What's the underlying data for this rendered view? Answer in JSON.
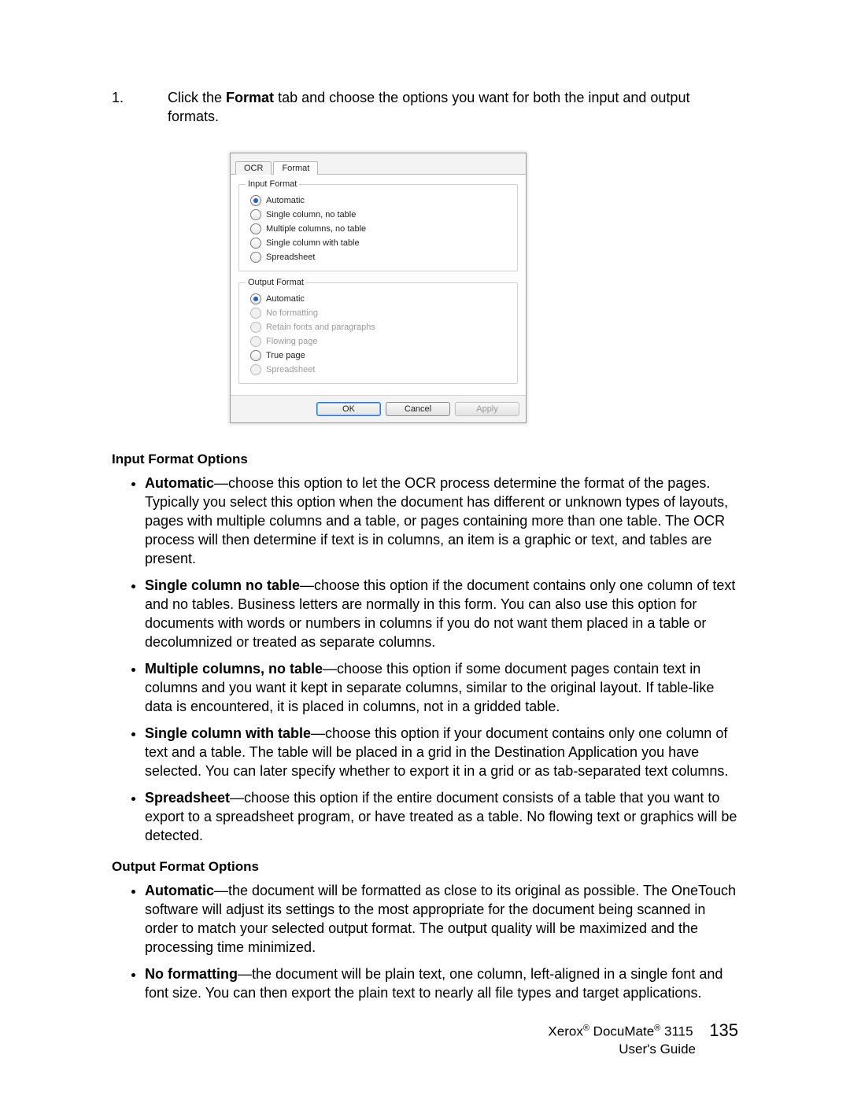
{
  "step": {
    "number": "1.",
    "before": "Click the ",
    "bold": "Format",
    "after": " tab and choose the options you want for both the input and output formats."
  },
  "dialog": {
    "tabs": {
      "ocr": "OCR",
      "format": "Format"
    },
    "input_group": {
      "legend": "Input Format",
      "options": [
        {
          "label": "Automatic",
          "selected": true,
          "disabled": false
        },
        {
          "label": "Single column, no table",
          "selected": false,
          "disabled": false
        },
        {
          "label": "Multiple columns, no table",
          "selected": false,
          "disabled": false
        },
        {
          "label": "Single column with table",
          "selected": false,
          "disabled": false
        },
        {
          "label": "Spreadsheet",
          "selected": false,
          "disabled": false
        }
      ]
    },
    "output_group": {
      "legend": "Output Format",
      "options": [
        {
          "label": "Automatic",
          "selected": true,
          "disabled": false
        },
        {
          "label": "No formatting",
          "selected": false,
          "disabled": true
        },
        {
          "label": "Retain fonts and paragraphs",
          "selected": false,
          "disabled": true
        },
        {
          "label": "Flowing page",
          "selected": false,
          "disabled": true
        },
        {
          "label": "True page",
          "selected": false,
          "disabled": false
        },
        {
          "label": "Spreadsheet",
          "selected": false,
          "disabled": true
        }
      ]
    },
    "buttons": {
      "ok": "OK",
      "cancel": "Cancel",
      "apply": "Apply"
    }
  },
  "input_heading": "Input Format Options",
  "input_items": [
    {
      "term": "Automatic",
      "text": "—choose this option to let the OCR process determine the format of the pages. Typically you select this option when the document has different or unknown types of layouts, pages with multiple columns and a table, or pages containing more than one table. The OCR process will then determine if text is in columns, an item is a graphic or text, and tables are present."
    },
    {
      "term": "Single column no table",
      "text": "—choose this option if the document contains only one column of text and no tables. Business letters are normally in this form. You can also use this option for documents with words or numbers in columns if you do not want them placed in a table or decolumnized or treated as separate columns."
    },
    {
      "term": "Multiple columns, no table",
      "text": "—choose this option if some document pages contain text in columns and you want it kept in separate columns, similar to the original layout. If table-like data is encountered, it is placed in columns, not in a gridded table."
    },
    {
      "term": "Single column with table",
      "text": "—choose this option if your document contains only one column of text and a table. The table will be placed in a grid in the Destination Application you have selected. You can later specify whether to export it in a grid or as tab-separated text columns."
    },
    {
      "term": "Spreadsheet",
      "text": "—choose this option if the entire document consists of a table that you want to export to a spreadsheet program, or have treated as a table. No flowing text or graphics will be detected."
    }
  ],
  "output_heading": "Output Format Options",
  "output_items": [
    {
      "term": "Automatic",
      "text": "—the document will be formatted as close to its original as possible. The OneTouch software will adjust its settings to the most appropriate for the document being scanned in order to match your selected output format. The output quality will be maximized and the processing time minimized."
    },
    {
      "term": "No formatting",
      "text": "—the document will be plain text, one column, left-aligned in a single font and font size. You can then export the plain text to nearly all file types and target applications."
    }
  ],
  "footer": {
    "product_before": "Xerox",
    "product_mid": " DocuMate",
    "product_after": " 3115",
    "guide": "User's Guide",
    "page": "135"
  }
}
